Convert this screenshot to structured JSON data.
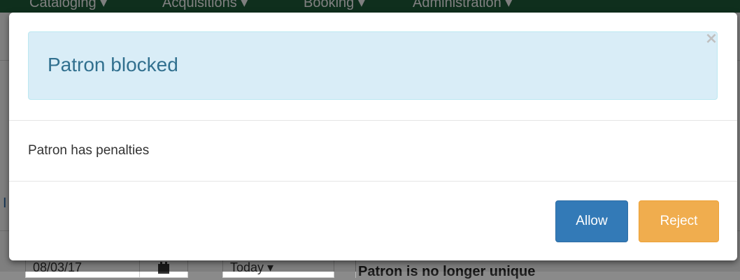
{
  "background": {
    "navbar": {
      "items": [
        "Cataloging ▾",
        "Acquisitions ▾",
        "Booking ▾",
        "Administration ▾"
      ]
    },
    "left_char": "I",
    "date_value": "08/03/17",
    "calendar_icon": "calendar-icon",
    "today_button": "Today ▾",
    "bold_text": "Patron is no longer unique"
  },
  "modal": {
    "title": "Patron blocked",
    "close_symbol": "×",
    "message": "Patron has penalties",
    "buttons": {
      "allow_label": "Allow",
      "reject_label": "Reject"
    }
  },
  "colors": {
    "alert_bg": "#d9edf7",
    "alert_text": "#31708f",
    "primary": "#337ab7",
    "warning": "#f0ad4e",
    "navbar": "#1f5f3a"
  }
}
